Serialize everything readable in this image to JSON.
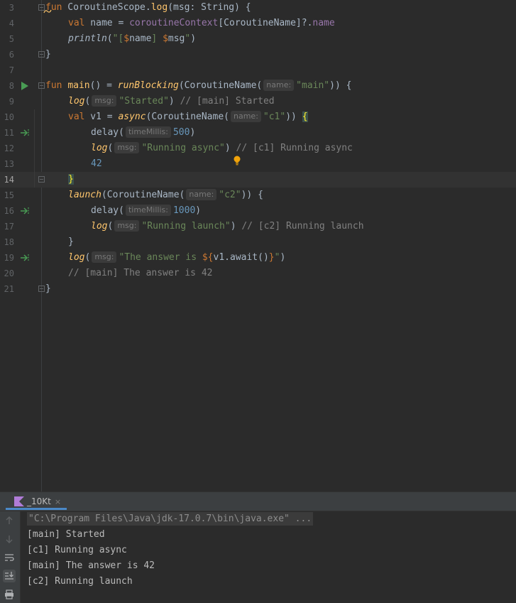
{
  "editor": {
    "line_numbers": [
      "3",
      "4",
      "5",
      "6",
      "7",
      "8",
      "9",
      "10",
      "11",
      "12",
      "13",
      "14",
      "15",
      "16",
      "17",
      "18",
      "19",
      "20",
      "21"
    ],
    "current_line": "14",
    "hints": {
      "name": "name:",
      "msg": "msg:",
      "timeMillis": "timeMillis:"
    },
    "code": {
      "l3_fun": "fun",
      "l3_scope": " CoroutineScope.",
      "l3_log": "log",
      "l3_rest": "(msg: String) {",
      "l4_val": "val",
      "l4_name": " name = ",
      "l4_ctx": "coroutineContext",
      "l4_mid": "[CoroutineName]?.",
      "l4_prop": "name",
      "l5_println": "println",
      "l5_open": "(",
      "l5_s1": "\"[",
      "l5_e1": "$",
      "l5_v1": "name",
      "l5_s2": "] ",
      "l5_e2": "$",
      "l5_v2": "msg",
      "l5_s3": "\"",
      "l5_close": ")",
      "l6": "}",
      "l8_fun": "fun",
      "l8_main": "main",
      "l8_eq": "() = ",
      "l8_rb": "runBlocking",
      "l8_cn": "(CoroutineName(",
      "l8_str": "\"main\"",
      "l8_end": ")) {",
      "l9_log": "log",
      "l9_open": "(",
      "l9_str": "\"Started\"",
      "l9_close": ") ",
      "l9_cmt": "// [main] Started",
      "l10_val": "val",
      "l10_v1": " v1 = ",
      "l10_async": "async",
      "l10_cn": "(CoroutineName(",
      "l10_str": "\"c1\"",
      "l10_end": ")) ",
      "l10_brace": "{",
      "l11_delay": "delay(",
      "l11_num": "500",
      "l11_close": ")",
      "l12_log": "log",
      "l12_open": "(",
      "l12_str": "\"Running async\"",
      "l12_close": ") ",
      "l12_cmt": "// [c1] Running async",
      "l13_num": "42",
      "l14_brace": "}",
      "l15_launch": "launch",
      "l15_cn": "(CoroutineName(",
      "l15_str": "\"c2\"",
      "l15_end": ")) {",
      "l16_delay": "delay(",
      "l16_num": "1000",
      "l16_close": ")",
      "l17_log": "log",
      "l17_open": "(",
      "l17_str": "\"Running launch\"",
      "l17_close": ") ",
      "l17_cmt": "// [c2] Running launch",
      "l18": "}",
      "l19_log": "log",
      "l19_open": "(",
      "l19_s1": "\"The answer is ",
      "l19_e1": "${",
      "l19_expr": "v1.await()",
      "l19_e2": "}",
      "l19_s2": "\"",
      "l19_close": ")",
      "l20_cmt": "// [main] The answer is 42",
      "l21": "}"
    }
  },
  "run_panel": {
    "tab_label": "_10Kt",
    "tab_close": "×",
    "command": "\"C:\\Program Files\\Java\\jdk-17.0.7\\bin\\java.exe\" ...",
    "output": [
      "[main] Started",
      "[c1] Running async",
      "[main] The answer is 42",
      "[c2] Running launch"
    ]
  },
  "colors": {
    "background": "#2b2b2b",
    "keyword": "#cc7832",
    "function": "#ffc66d",
    "string": "#6a8759",
    "number": "#6897bb",
    "comment": "#808080",
    "property": "#9876aa",
    "run_icon": "#499c54",
    "accent": "#4a88c7"
  }
}
